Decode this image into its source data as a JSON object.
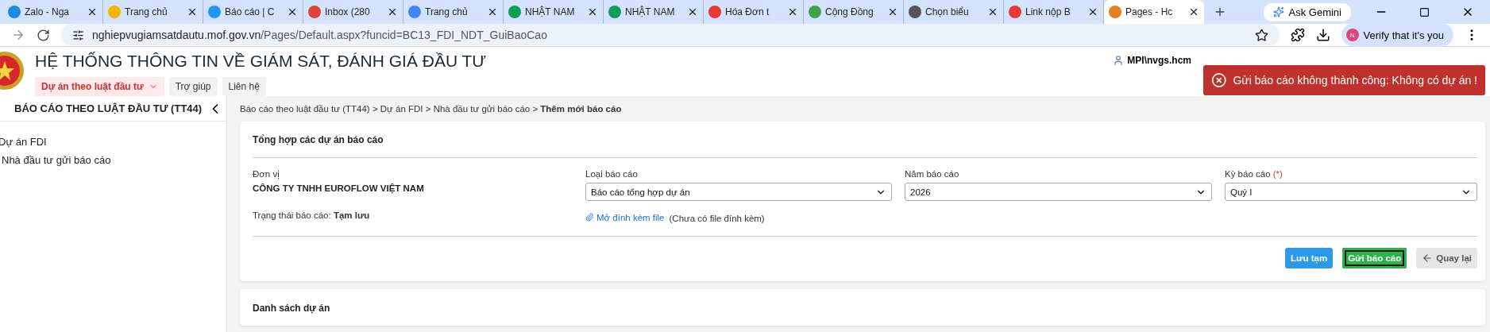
{
  "browser": {
    "tabs": [
      {
        "label": "Zalo - Nga",
        "selected": false
      },
      {
        "label": "Trang chủ",
        "selected": false
      },
      {
        "label": "Báo cáo | C",
        "selected": false
      },
      {
        "label": "Inbox (280",
        "selected": false
      },
      {
        "label": "Trang chủ",
        "selected": false
      },
      {
        "label": "NHẬT NAM",
        "selected": false
      },
      {
        "label": "NHẬT NAM",
        "selected": false
      },
      {
        "label": "Hóa Đơn t",
        "selected": false
      },
      {
        "label": "Cộng Đồng",
        "selected": false
      },
      {
        "label": "Chọn biểu",
        "selected": false
      },
      {
        "label": "Link nộp B",
        "selected": false
      },
      {
        "label": "Pages - Hc",
        "selected": true
      }
    ],
    "gemini": "Ask Gemini",
    "url_host": "nghiepvugiamsatdautu.mof.gov.vn",
    "url_path": "/Pages/Default.aspx?funcid=BC13_FDI_NDT_GuiBaoCao",
    "avatar_letter": "N",
    "verify": "Verify that it's you"
  },
  "header": {
    "title": "HỆ THỐNG THÔNG TIN VỀ GIÁM SÁT, ĐÁNH GIÁ ĐẦU TƯ",
    "menu": [
      {
        "label": "Dự án theo luật đầu tư",
        "selected": true
      },
      {
        "label": "Trợ giúp",
        "selected": false
      },
      {
        "label": "Liên hệ",
        "selected": false
      }
    ],
    "user": "MPI\\nvgs.hcm"
  },
  "toast": {
    "message": "Gửi báo cáo không thành công: Không có dự án !"
  },
  "sidebar": {
    "title": "BÁO CÁO THEO LUẬT ĐẦU TƯ (TT44)",
    "items": [
      {
        "label": "Dự án FDI",
        "children": [
          {
            "label": "Nhà đầu tư gửi báo cáo"
          }
        ]
      }
    ]
  },
  "breadcrumb": {
    "items": [
      "Báo cáo theo luật đầu tư (TT44)",
      "Dự án FDI",
      "Nhà đầu tư gửi báo cáo"
    ],
    "current": "Thêm mới báo cáo",
    "separator": ">"
  },
  "form": {
    "title": "Tổng hợp các dự án báo cáo",
    "unit_label": "Đơn vị",
    "unit_value": "CÔNG TY TNHH EUROFLOW VIỆT NAM",
    "fields": [
      {
        "label": "Loại báo cáo",
        "value": "Báo cáo tổng hợp dự án"
      },
      {
        "label": "Năm báo cáo",
        "value": "2026"
      },
      {
        "label": "Kỳ báo cáo",
        "value": "Quý I",
        "required_mark": "(*)"
      }
    ],
    "status_label": "Trạng thái báo cáo:",
    "status_value": "Tạm lưu",
    "attach_link": "Mở đính kèm file",
    "attach_note": "(Chưa có file đính kèm)",
    "buttons": [
      {
        "kind": "save",
        "label": "Lưu tạm",
        "focused": false
      },
      {
        "kind": "submit",
        "label": "Gửi báo cáo",
        "focused": true
      },
      {
        "kind": "back",
        "label": "Quay lại",
        "focused": false
      }
    ]
  },
  "projects": {
    "title": "Danh sách dự án"
  }
}
